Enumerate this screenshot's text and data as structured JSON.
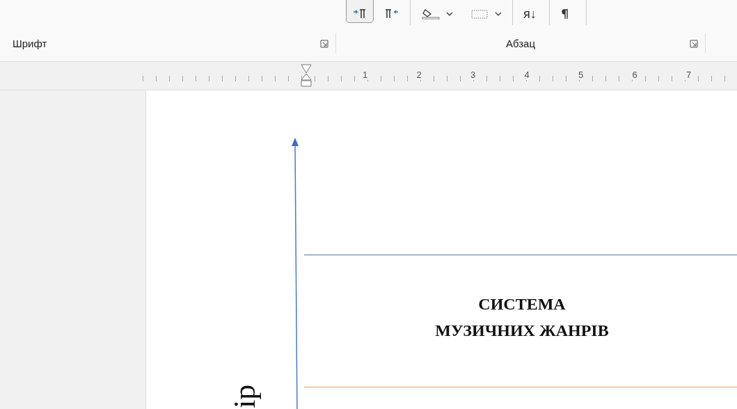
{
  "ribbon": {
    "buttons": [
      {
        "kind": "ltr",
        "selected": true,
        "dropdown": false
      },
      {
        "kind": "rtl",
        "selected": false,
        "dropdown": false
      },
      {
        "kind": "shading",
        "selected": false,
        "dropdown": true
      },
      {
        "kind": "borders",
        "selected": false,
        "dropdown": true
      },
      {
        "kind": "sort",
        "selected": false,
        "dropdown": false,
        "glyph": "я↓"
      },
      {
        "kind": "pilcrow",
        "selected": false,
        "dropdown": false
      }
    ],
    "groups": [
      {
        "label": "Шрифт"
      },
      {
        "label": "Абзац"
      }
    ]
  },
  "ruler": {
    "numbers": [
      "1",
      "2",
      "3",
      "4",
      "5",
      "6",
      "7"
    ]
  },
  "document": {
    "title_lines": [
      "СИСТЕМА",
      "МУЗИЧНИХ ЖАНРІВ"
    ],
    "axis_label": "ір"
  }
}
